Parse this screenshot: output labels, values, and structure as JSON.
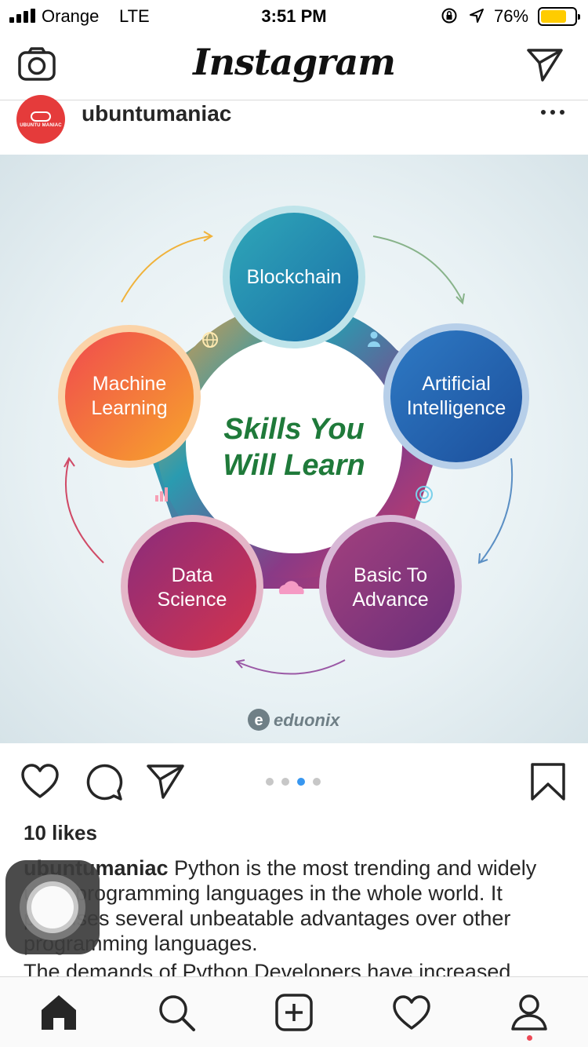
{
  "status_bar": {
    "carrier": "Orange",
    "network": "LTE",
    "time": "3:51 PM",
    "battery_percent": "76%",
    "battery_level": 0.76,
    "icons": [
      "signal-icon",
      "orientation-lock-icon",
      "location-icon",
      "battery-icon"
    ]
  },
  "nav": {
    "logo": "Instagram",
    "left_icon": "camera-icon",
    "right_icon": "direct-message-icon"
  },
  "post": {
    "username": "ubuntumaniac",
    "avatar_text": "UBUNTU MANIAC",
    "image": {
      "center_title_line1": "Skills You",
      "center_title_line2": "Will Learn",
      "nodes": [
        {
          "line1": "Blockchain",
          "line2": ""
        },
        {
          "line1": "Artificial",
          "line2": "Intelligence"
        },
        {
          "line1": "Basic To",
          "line2": "Advance"
        },
        {
          "line1": "Data",
          "line2": "Science"
        },
        {
          "line1": "Machine",
          "line2": "Learning"
        }
      ],
      "brand": "eduonix"
    },
    "carousel": {
      "count": 4,
      "active_index": 2
    },
    "likes": "10 likes",
    "caption_user": "ubuntumaniac",
    "caption_text": "Python is the most trending and widely used programming languages in the whole world. It promises several unbeatable advantages over other programming languages.",
    "caption_more": "The demands of Python Developers have increased"
  },
  "tabs": [
    "home-icon",
    "search-icon",
    "new-post-icon",
    "activity-icon",
    "profile-icon"
  ]
}
